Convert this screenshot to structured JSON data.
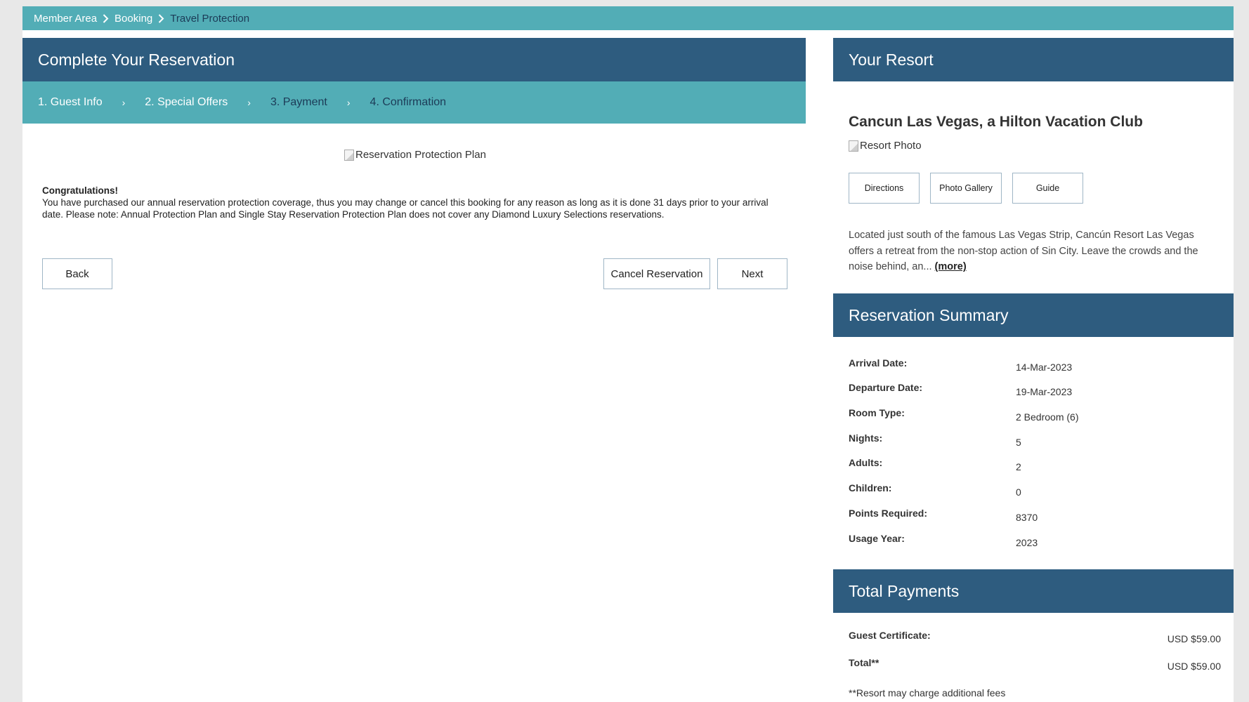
{
  "breadcrumb": {
    "items": [
      "Member Area",
      "Booking",
      "Travel Protection"
    ]
  },
  "reservation": {
    "title": "Complete Your Reservation",
    "steps": [
      "1. Guest Info",
      "2. Special Offers",
      "3. Payment",
      "4. Confirmation"
    ],
    "image_alt": "Reservation Protection Plan",
    "congrats_title": "Congratulations!",
    "congrats_text": "You have purchased our annual reservation protection coverage, thus you may change or cancel this booking for any reason as long as it is done 31 days prior to your arrival date. Please note: Annual Protection Plan and Single Stay Reservation Protection Plan does not cover any Diamond Luxury Selections reservations.",
    "back_label": "Back",
    "cancel_label": "Cancel Reservation",
    "next_label": "Next"
  },
  "resort": {
    "section_title": "Your Resort",
    "name": "Cancun Las Vegas, a Hilton Vacation Club",
    "photo_alt": "Resort Photo",
    "directions_label": "Directions",
    "gallery_label": "Photo Gallery",
    "guide_label": "Guide",
    "description": "Located just south of the famous Las Vegas Strip, Cancún Resort Las Vegas offers a retreat from the non-stop action of Sin City. Leave the crowds and the noise behind, an...",
    "more_label": "(more)"
  },
  "summary": {
    "section_title": "Reservation Summary",
    "rows": [
      {
        "label": "Arrival Date:",
        "value": "14-Mar-2023"
      },
      {
        "label": "Departure Date:",
        "value": "19-Mar-2023"
      },
      {
        "label": "Room Type:",
        "value": "2 Bedroom (6)"
      },
      {
        "label": "Nights:",
        "value": "5"
      },
      {
        "label": "Adults:",
        "value": "2"
      },
      {
        "label": "Children:",
        "value": "0"
      },
      {
        "label": "Points Required:",
        "value": "8370"
      },
      {
        "label": "Usage Year:",
        "value": "2023"
      }
    ]
  },
  "payments": {
    "section_title": "Total Payments",
    "rows": [
      {
        "label": "Guest Certificate:",
        "value": "USD $59.00"
      },
      {
        "label": "Total**",
        "value": "USD $59.00"
      }
    ],
    "note": "**Resort may charge additional fees"
  },
  "colors": {
    "header_navy": "#2e5c7f",
    "teal_bar": "#52adb6",
    "button_border": "#9fb6c6"
  }
}
